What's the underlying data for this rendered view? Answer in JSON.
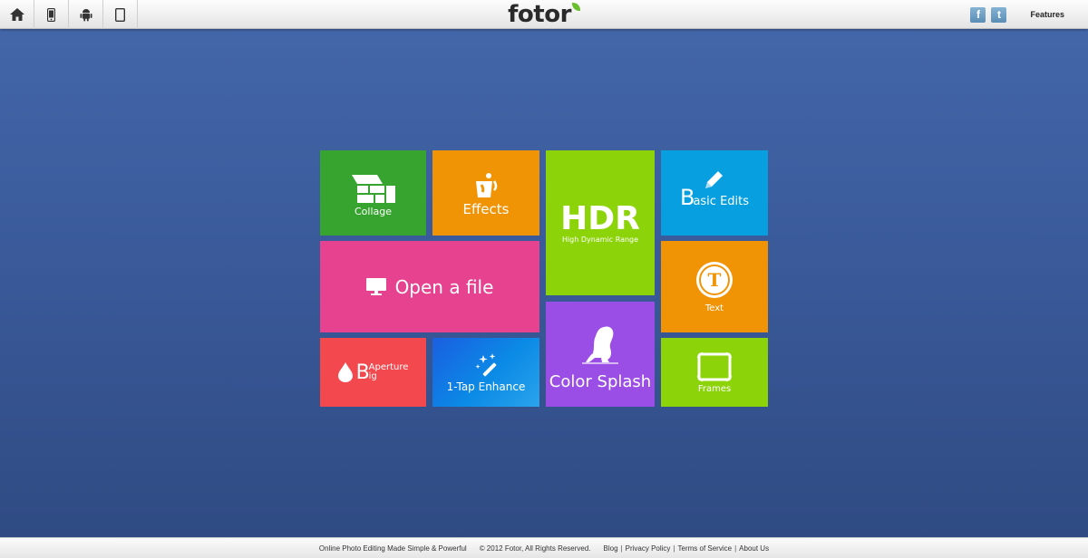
{
  "header": {
    "logo_text": "foto",
    "logo_suffix": "r",
    "features_label": "Features",
    "social": {
      "facebook": "f",
      "twitter": "t"
    }
  },
  "tiles": {
    "collage": "Collage",
    "effects": "Effects",
    "hdr_title": "HDR",
    "hdr_subtitle": "High Dynamic Range",
    "basic_big_letter": "B",
    "basic_rest": "asic Edits",
    "open_file": "Open a file",
    "text": "Text",
    "text_icon_letter": "T",
    "color_splash": "Color Splash",
    "big_letter": "B",
    "big_top": "Aperture",
    "big_bottom": "ig",
    "enhance": "1-Tap Enhance",
    "frames": "Frames"
  },
  "footer": {
    "tagline": "Online Photo Editing Made Simple & Powerful",
    "copyright": "© 2012 Fotor, All Rights Reserved.",
    "links": [
      "Blog",
      "Privacy Policy",
      "Terms of Service",
      "About Us"
    ]
  },
  "colors": {
    "collage": "#36a42f",
    "effects": "#f09406",
    "hdr": "#8dd30a",
    "basic": "#079fe0",
    "open": "#e6428f",
    "text": "#f09406",
    "splash": "#9b4ee6",
    "big": "#f2484e",
    "enhance": "#0b8ae6",
    "frames": "#8dd30a"
  }
}
